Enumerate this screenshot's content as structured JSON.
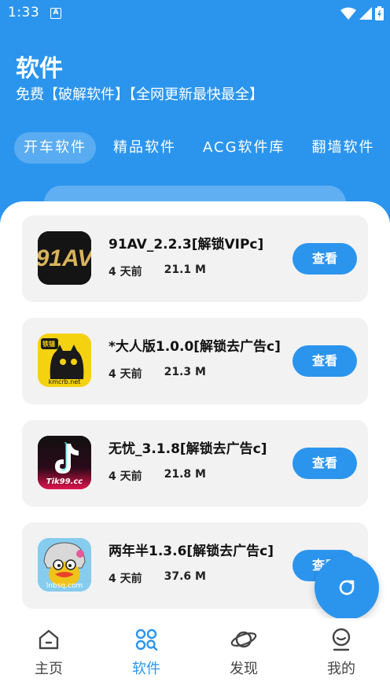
{
  "status_bar": {
    "time": "1:33",
    "notif_icon": "A"
  },
  "header": {
    "title": "软件",
    "subtitle": "免费【破解软件】【全网更新最快最全】"
  },
  "tabs": [
    {
      "label": "开车软件",
      "active": true
    },
    {
      "label": "精品软件",
      "active": false
    },
    {
      "label": "ACG软件库",
      "active": false
    },
    {
      "label": "翻墙软件",
      "active": false
    }
  ],
  "apps": [
    {
      "name": "91AV_2.2.3[解锁VIPc]",
      "age": "4 天前",
      "size": "21.1 M",
      "button": "查看",
      "icon": "91av-logo-icon"
    },
    {
      "name": "*大人版1.0.0[解锁去广告c]",
      "age": "4 天前",
      "size": "21.3 M",
      "button": "查看",
      "icon": "black-cat-icon"
    },
    {
      "name": "无忧_3.1.8[解锁去广告c]",
      "age": "4 天前",
      "size": "21.8 M",
      "button": "查看",
      "icon": "tiktok-style-icon"
    },
    {
      "name": "两年半1.3.6[解锁去广告c]",
      "age": "4 天前",
      "size": "37.6 M",
      "button": "查看",
      "icon": "cartoon-bird-icon"
    }
  ],
  "icon_texts": {
    "kmcrb": "kmcrb.net",
    "tik99": "Tik99.cc",
    "lnbsq": "lnbsq.com",
    "tietie": "铁锚"
  },
  "bottom_nav": [
    {
      "label": "主页",
      "icon": "home-icon",
      "active": false
    },
    {
      "label": "软件",
      "icon": "apps-grid-icon",
      "active": true
    },
    {
      "label": "发现",
      "icon": "planet-icon",
      "active": false
    },
    {
      "label": "我的",
      "icon": "profile-icon",
      "active": false
    }
  ],
  "colors": {
    "primary": "#2b95ee",
    "card": "#f2f2f2"
  }
}
